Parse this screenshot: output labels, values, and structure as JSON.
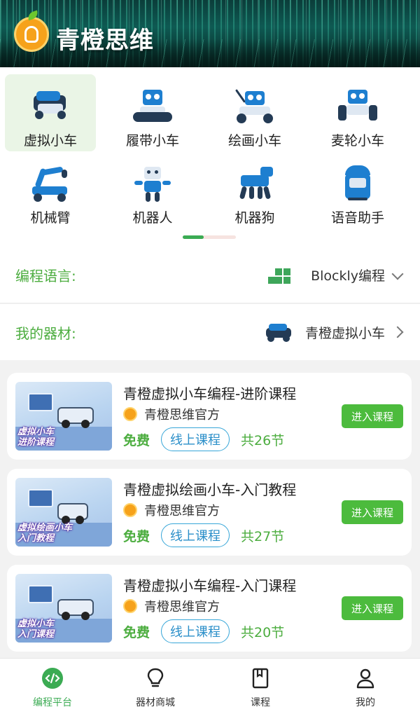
{
  "header": {
    "brand": "青橙思维"
  },
  "categories": [
    {
      "label": "虚拟小车",
      "icon": "virtual-car-icon",
      "active": true
    },
    {
      "label": "履带小车",
      "icon": "tracked-car-icon"
    },
    {
      "label": "绘画小车",
      "icon": "drawing-car-icon"
    },
    {
      "label": "麦轮小车",
      "icon": "mecanum-car-icon"
    },
    {
      "label": "机械臂",
      "icon": "robot-arm-icon"
    },
    {
      "label": "机器人",
      "icon": "robot-icon"
    },
    {
      "label": "机器狗",
      "icon": "robot-dog-icon"
    },
    {
      "label": "语音助手",
      "icon": "voice-assistant-icon"
    }
  ],
  "pager": {
    "pages": 2,
    "current": 1
  },
  "settings": {
    "language": {
      "label": "编程语言:",
      "value": "Blockly编程"
    },
    "equipment": {
      "label": "我的器材:",
      "value": "青橙虚拟小车"
    }
  },
  "courses": [
    {
      "title": "青橙虚拟小车编程-进阶课程",
      "author": "青橙思维官方",
      "price": "免费",
      "tag": "线上课程",
      "count": "共26节",
      "button": "进入课程",
      "thumb_caption": "虚拟小车\n进阶课程"
    },
    {
      "title": "青橙虚拟绘画小车-入门教程",
      "author": "青橙思维官方",
      "price": "免费",
      "tag": "线上课程",
      "count": "共27节",
      "button": "进入课程",
      "thumb_caption": "虚拟绘画小车\n入门教程"
    },
    {
      "title": "青橙虚拟小车编程-入门课程",
      "author": "青橙思维官方",
      "price": "免费",
      "tag": "线上课程",
      "count": "共20节",
      "button": "进入课程",
      "thumb_caption": "虚拟小车\n入门课程"
    }
  ],
  "nav": [
    {
      "label": "编程平台",
      "icon": "code-platform-icon",
      "active": true
    },
    {
      "label": "器材商城",
      "icon": "bulb-icon"
    },
    {
      "label": "课程",
      "icon": "book-icon"
    },
    {
      "label": "我的",
      "icon": "user-icon"
    }
  ],
  "colors": {
    "accent": "#4cbb3d",
    "tag_border": "#37a6d8",
    "active_bg": "#eaf5e6"
  }
}
